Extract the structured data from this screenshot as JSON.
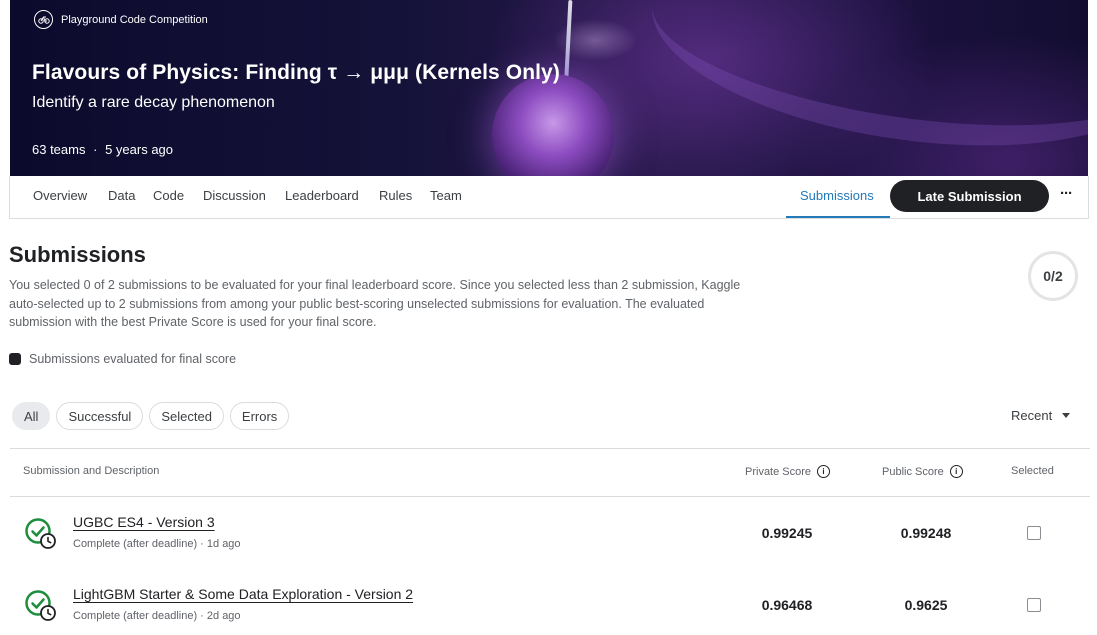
{
  "hero": {
    "competition_tag": "Playground Code Competition",
    "title": "Flavours of Physics: Finding τ → μμμ (Kernels Only)",
    "subtitle": "Identify a rare decay phenomenon",
    "teams": "63 teams",
    "separator": "·",
    "age": "5 years ago"
  },
  "tabs": {
    "items": [
      "Overview",
      "Data",
      "Code",
      "Discussion",
      "Leaderboard",
      "Rules",
      "Team"
    ],
    "submissions": "Submissions",
    "late_submission": "Late Submission",
    "more": "···"
  },
  "submissions": {
    "title": "Submissions",
    "description": "You selected 0 of 2 submissions to be evaluated for your final leaderboard score. Since you selected less than 2 submission, Kaggle auto-selected up to 2 submissions from among your public best-scoring unselected submissions for evaluation. The evaluated submission with the best Private Score is used for your final score.",
    "selected_count": "0/2",
    "legend": "Submissions evaluated for final score"
  },
  "filters": {
    "chips": [
      "All",
      "Successful",
      "Selected",
      "Errors"
    ],
    "sort": "Recent"
  },
  "table": {
    "headers": {
      "description": "Submission and Description",
      "private": "Private Score",
      "public": "Public Score",
      "selected": "Selected"
    },
    "rows": [
      {
        "title": "UGBC ES4 - Version 3",
        "meta": "Complete (after deadline) · 1d ago",
        "private_score": "0.99245",
        "public_score": "0.99248"
      },
      {
        "title": "LightGBM Starter & Some Data Exploration - Version 2",
        "meta": "Complete (after deadline) · 2d ago",
        "private_score": "0.96468",
        "public_score": "0.9625"
      }
    ]
  },
  "colors": {
    "accent": "#2479b8",
    "success": "#1e8e3e",
    "dark": "#202124"
  },
  "icons": {
    "competition": "bicycle-icon",
    "status": "check-circle-clock-icon",
    "info": "info-icon",
    "sort": "caret-down-icon"
  }
}
